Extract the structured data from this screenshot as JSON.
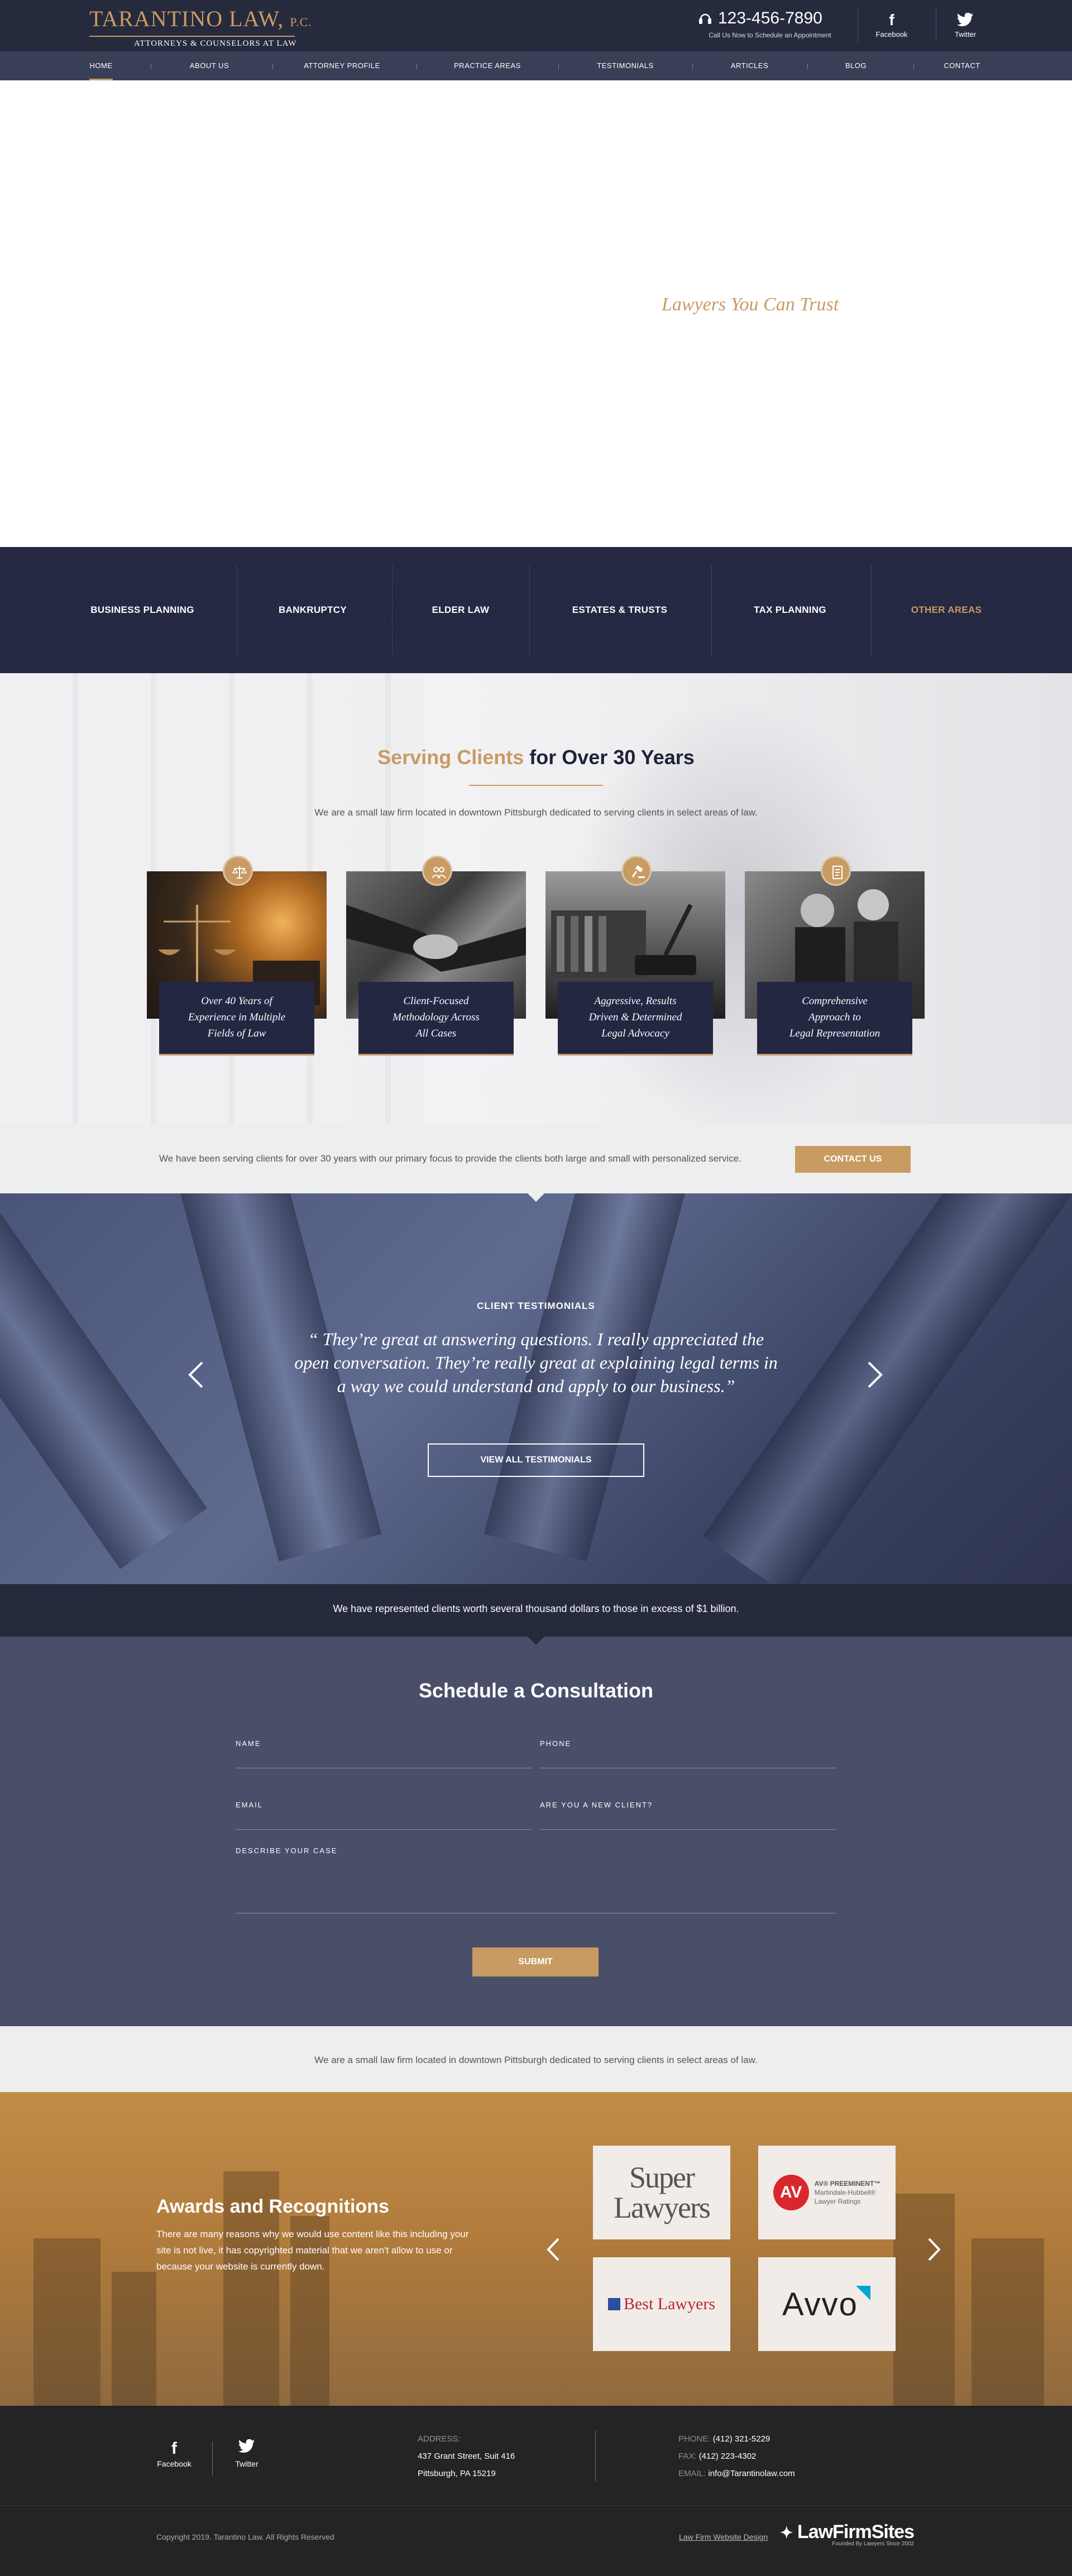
{
  "header": {
    "logo_name": "TARANTINO LAW",
    "logo_suffix": "P.C.",
    "logo_tagline": "ATTORNEYS & COUNSELORS AT LAW",
    "phone": "123-456-7890",
    "phone_sub": "Call Us Now to Schedule an Appointment",
    "social": [
      {
        "label": "Facebook",
        "icon": "f"
      },
      {
        "label": "Twitter",
        "icon": "twitter-bird"
      }
    ]
  },
  "nav": {
    "items": [
      {
        "label": "HOME"
      },
      {
        "label": "ABOUT US"
      },
      {
        "label": "ATTORNEY PROFILE"
      },
      {
        "label": "PRACTICE AREAS"
      },
      {
        "label": "TESTIMONIALS"
      },
      {
        "label": "ARTICLES"
      },
      {
        "label": "BLOG"
      },
      {
        "label": "CONTACT"
      }
    ]
  },
  "hero": {
    "tagline": "Lawyers You Can Trust"
  },
  "practice_areas": {
    "items": [
      {
        "label": "BUSINESS PLANNING"
      },
      {
        "label": "BANKRUPTCY"
      },
      {
        "label": "ELDER LAW"
      },
      {
        "label": "ESTATES & TRUSTS"
      },
      {
        "label": "TAX PLANNING"
      },
      {
        "label": "OTHER AREAS"
      }
    ]
  },
  "serving": {
    "title_gold": "Serving Clients",
    "title_rest": "for Over 30 Years",
    "intro": "We are a small law firm located in downtown Pittsburgh dedicated to serving clients in select areas of law.",
    "cards": [
      {
        "line1": "Over 40 Years of",
        "line2": "Experience in Multiple",
        "line3": "Fields of Law",
        "icon": "scales-icon"
      },
      {
        "line1": "Client-Focused",
        "line2": "Methodology Across",
        "line3": "All Cases",
        "icon": "people-icon"
      },
      {
        "line1": "Aggressive, Results",
        "line2": "Driven & Determined",
        "line3": "Legal Advocacy",
        "icon": "gavel-icon"
      },
      {
        "line1": "Comprehensive",
        "line2": "Approach to",
        "line3": "Legal Representation",
        "icon": "document-icon"
      }
    ]
  },
  "cta": {
    "text": "We have been serving clients for over 30 years with our primary focus to provide the clients both large and small with personalized service.",
    "button": "CONTACT US"
  },
  "testimonials": {
    "heading": "CLIENT TESTIMONIALS",
    "quote": "“ They’re great at answering questions. I really appreciated the open conversation. They’re really great at explaining legal terms in a way we could understand and apply to our business.”",
    "button": "VIEW ALL TESTIMONIALS"
  },
  "represent": {
    "text": "We have represented clients worth several thousand dollars to those in excess of $1 billion."
  },
  "schedule": {
    "title": "Schedule a Consultation",
    "fields": {
      "name": "NAME",
      "phone": "PHONE",
      "email": "EMAIL",
      "new_client": "ARE YOU A NEW CLIENT?",
      "describe": "DESCRIBE YOUR CASE"
    },
    "submit": "SUBMIT"
  },
  "small_law": {
    "text": "We are a small law firm located in downtown Pittsburgh dedicated to serving clients in select areas of law."
  },
  "awards": {
    "title": "Awards and Recognitions",
    "text": "There are many reasons why we would use content like this including your site is not live, it has copyrighted material that we aren't allow to use or because your website is currently down.",
    "logos": {
      "super_lawyers_1": "Super",
      "super_lawyers_2": "Lawyers",
      "av_badge": "AV",
      "av_title": "AV® PREEMINENT™",
      "av_sub1": "Martindale-Hubbell®",
      "av_sub2": "Lawyer Ratings",
      "best_lawyers": "Best Lawyers",
      "avvo": "Avvo"
    }
  },
  "footer": {
    "social": [
      {
        "label": "Facebook",
        "icon": "f"
      },
      {
        "label": "Twitter",
        "icon": "twitter-bird"
      }
    ],
    "address_label": "ADDRESS:",
    "address_line1": "437 Grant Street, Suit 416",
    "address_line2": "Pittsburgh, PA 15219",
    "phone_label": "PHONE:",
    "phone": "(412) 321-5229",
    "fax_label": "FAX:",
    "fax": "(412) 223-4302",
    "email_label": "EMAIL:",
    "email": "info@Tarantinolaw.com",
    "copyright": "Copyright 2019. Tarantino Law. All Rights Reserved",
    "design_link": "Law Firm Website Design",
    "lfs_logo": "LawFirmSites",
    "lfs_tag": "Founded By Lawyers Since 2002"
  },
  "colors": {
    "navy": "#262a3d",
    "nav": "#3a3f58",
    "gold": "#c89b63",
    "slate": "#4a4f69"
  }
}
